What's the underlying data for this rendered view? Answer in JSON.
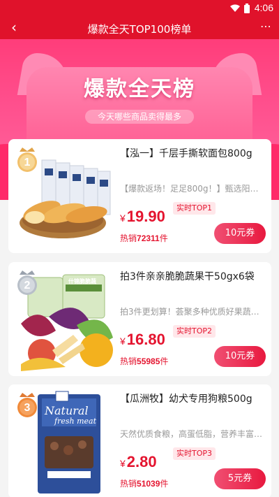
{
  "status_bar": {
    "time": "4:06"
  },
  "nav": {
    "back_icon": "chevron-left-icon",
    "title": "爆款全天TOP100榜单",
    "more_icon": "more-dots-icon"
  },
  "hero": {
    "title": "爆款全天榜",
    "subtitle": "今天哪些商品卖得最多"
  },
  "products": [
    {
      "rank": "1",
      "name": "【泓一】千层手撕软面包800g",
      "desc": "【爆款返场！足足800g！】甄选阳光…",
      "price_symbol": "¥",
      "price": "19.90",
      "rank_badge": "实时TOP1",
      "sold_prefix": "热销",
      "sold_count": "72311",
      "sold_suffix": "件",
      "coupon": "10元券"
    },
    {
      "rank": "2",
      "name": "拍3件亲亲脆脆蔬果干50gx6袋",
      "desc": "拍3件更划算！荟聚多种优质好果蔬…",
      "price_symbol": "¥",
      "price": "16.80",
      "rank_badge": "实时TOP2",
      "sold_prefix": "热销",
      "sold_count": "55985",
      "sold_suffix": "件",
      "coupon": "10元券",
      "package_text": "什锦脆脆蔬"
    },
    {
      "rank": "3",
      "name": "【瓜洲牧】幼犬专用狗粮500g",
      "desc": "天然优质食粮，高蛋低脂，营养丰富…",
      "price_symbol": "¥",
      "price": "2.80",
      "rank_badge": "实时TOP3",
      "sold_prefix": "热销",
      "sold_count": "51039",
      "sold_suffix": "件",
      "coupon": "5元券",
      "package_text_1": "Natural",
      "package_text_2": "fresh meat"
    }
  ],
  "colors": {
    "brand_red": "#e0122b",
    "hero_pink": "#ff4f8d",
    "price_red": "#e4142f"
  }
}
